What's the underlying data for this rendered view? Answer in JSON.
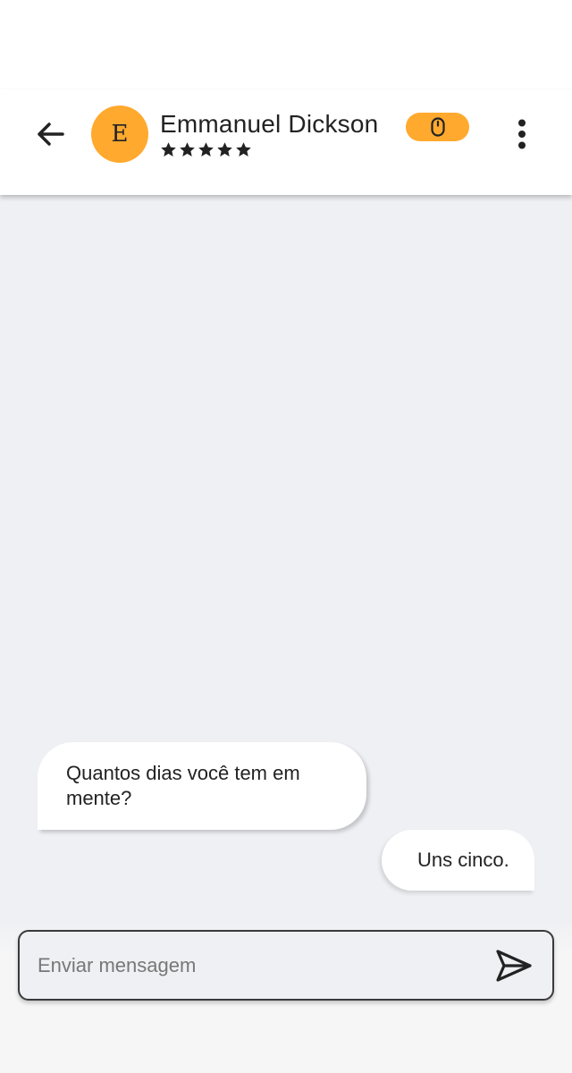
{
  "header": {
    "avatar_initial": "E",
    "contact_name": "Emmanuel Dickson",
    "rating_stars": 5,
    "back_icon": "arrow-left-icon",
    "badge_icon": "mouse-icon",
    "menu_icon": "more-vertical-icon"
  },
  "messages": [
    {
      "direction": "received",
      "text": "Quantos dias você tem em mente?"
    },
    {
      "direction": "sent",
      "text": "Uns cinco."
    }
  ],
  "composer": {
    "placeholder": "Enviar mensagem",
    "value": "",
    "send_icon": "send-icon"
  },
  "colors": {
    "accent": "#ffa92e",
    "background": "#eff0f4",
    "bubble": "#ffffff",
    "text": "#222222",
    "placeholder": "#777777"
  }
}
